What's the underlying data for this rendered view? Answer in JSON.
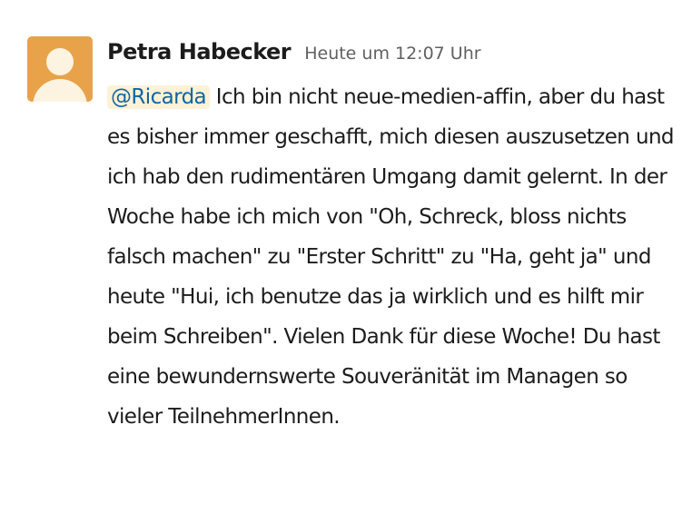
{
  "message": {
    "sender": "Petra Habecker",
    "timestamp": "Heute um 12:07 Uhr",
    "mention": "@Ricarda",
    "text": " Ich bin nicht neue-medien-affin, aber du hast es bisher immer geschafft, mich diesen auszusetzen und ich hab den rudimentären Umgang damit gelernt. In der Woche habe ich mich von \"Oh, Schreck, bloss nichts falsch machen\" zu \"Erster Schritt\" zu \"Ha, geht ja\" und heute \"Hui, ich benutze das ja wirklich und es hilft mir beim Schreiben\". Vielen Dank für diese Woche! Du hast eine bewundernswerte Souveränität im Managen so vieler TeilnehmerInnen."
  },
  "avatar": {
    "icon": "user-silhouette-icon",
    "background_color": "#e8a34a"
  },
  "colors": {
    "mention_background": "#fdf2d6",
    "mention_text": "#1264a3",
    "timestamp": "#616061"
  }
}
